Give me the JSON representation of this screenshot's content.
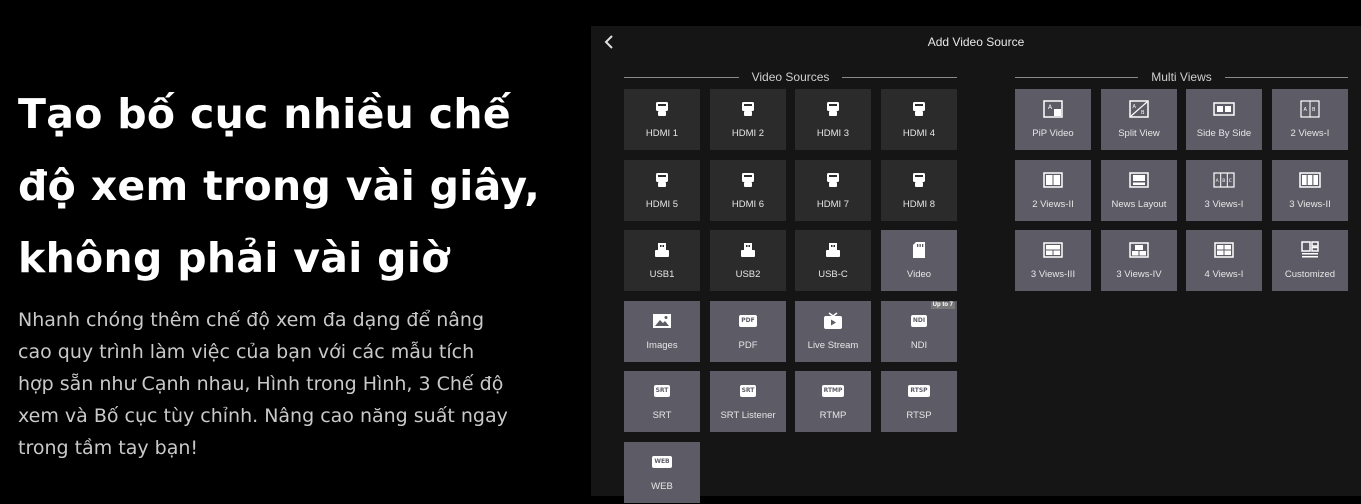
{
  "hero": {
    "headline_1": "Tạo bố cục nhiều chế",
    "headline_2": "độ xem trong vài giây,",
    "headline_3": "không phải vài giờ",
    "body_1": "Nhanh chóng thêm chế độ xem đa dạng để nâng",
    "body_2": "cao quy trình làm việc của bạn với các mẫu tích",
    "body_3": "hợp sẵn như Cạnh nhau, Hình trong Hình, 3 Chế độ",
    "body_4": "xem và Bố cục tùy chỉnh. Nâng cao năng suất ngay",
    "body_5": "trong tầm tay bạn!"
  },
  "panel": {
    "title": "Add Video Source",
    "back_icon": "chevron-left-icon",
    "video_sources_title": "Video Sources",
    "multi_views_title": "Multi Views",
    "video_sources": [
      {
        "label": "HDMI 1",
        "icon": "hdmi-icon"
      },
      {
        "label": "HDMI 2",
        "icon": "hdmi-icon"
      },
      {
        "label": "HDMI 3",
        "icon": "hdmi-icon"
      },
      {
        "label": "HDMI 4",
        "icon": "hdmi-icon"
      },
      {
        "label": "HDMI 5",
        "icon": "hdmi-icon"
      },
      {
        "label": "HDMI 6",
        "icon": "hdmi-icon"
      },
      {
        "label": "HDMI 7",
        "icon": "hdmi-icon"
      },
      {
        "label": "HDMI 8",
        "icon": "hdmi-icon"
      },
      {
        "label": "USB1",
        "icon": "usb-icon"
      },
      {
        "label": "USB2",
        "icon": "usb-icon"
      },
      {
        "label": "USB-C",
        "icon": "usb-icon"
      },
      {
        "label": "Video",
        "icon": "sd-card-icon"
      },
      {
        "label": "Images",
        "icon": "image-icon"
      },
      {
        "label": "PDF",
        "icon": "pdf-icon",
        "icon_text": "PDF"
      },
      {
        "label": "Live Stream",
        "icon": "live-stream-icon"
      },
      {
        "label": "NDI",
        "icon": "ndi-icon",
        "icon_text": "NDI",
        "badge": "Up to 7"
      },
      {
        "label": "SRT",
        "icon": "srt-icon",
        "icon_text": "SRT"
      },
      {
        "label": "SRT Listener",
        "icon": "srt-icon",
        "icon_text": "SRT"
      },
      {
        "label": "RTMP",
        "icon": "rtmp-icon",
        "icon_text": "RTMP"
      },
      {
        "label": "RTSP",
        "icon": "rtsp-icon",
        "icon_text": "RTSP"
      },
      {
        "label": "WEB",
        "icon": "web-icon",
        "icon_text": "WEB"
      }
    ],
    "multi_views": [
      {
        "label": "PiP Video",
        "icon": "pip-video-icon"
      },
      {
        "label": "Split View",
        "icon": "split-view-icon"
      },
      {
        "label": "Side By Side",
        "icon": "side-by-side-icon"
      },
      {
        "label": "2 Views-I",
        "icon": "two-views-i-icon"
      },
      {
        "label": "2 Views-II",
        "icon": "two-views-ii-icon"
      },
      {
        "label": "News Layout",
        "icon": "news-layout-icon"
      },
      {
        "label": "3 Views-I",
        "icon": "three-views-i-icon"
      },
      {
        "label": "3 Views-II",
        "icon": "three-views-ii-icon"
      },
      {
        "label": "3 Views-III",
        "icon": "three-views-iii-icon"
      },
      {
        "label": "3 Views-IV",
        "icon": "three-views-iv-icon"
      },
      {
        "label": "4 Views-I",
        "icon": "four-views-i-icon"
      },
      {
        "label": "Customized",
        "icon": "customized-layout-icon"
      }
    ]
  },
  "colors": {
    "page_bg": "#000000",
    "panel_bg": "#151515",
    "tile_dark": "#2b2b2b",
    "tile_light": "#5d5c66"
  }
}
